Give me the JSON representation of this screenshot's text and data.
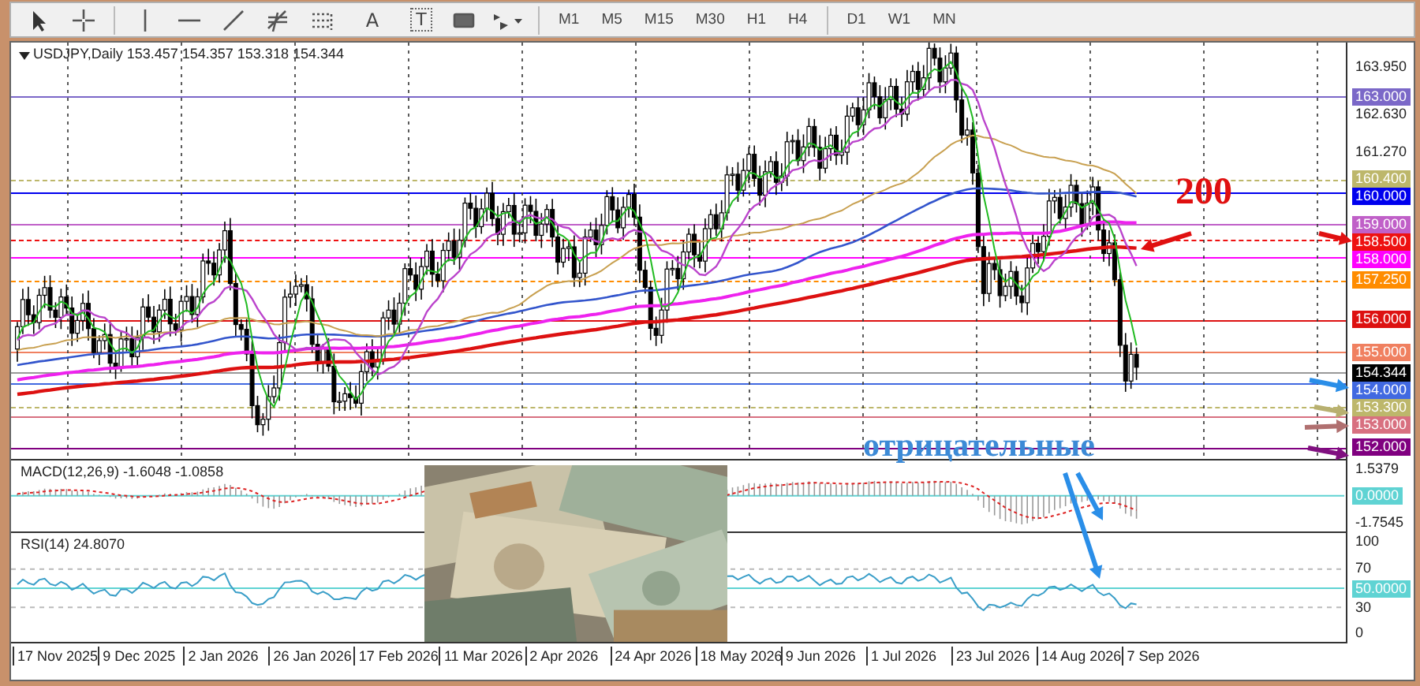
{
  "toolbar": {
    "tool_groups": [
      [
        {
          "kind": "cursor"
        },
        {
          "kind": "crosshair"
        }
      ],
      [
        {
          "kind": "vline"
        },
        {
          "kind": "hline"
        },
        {
          "kind": "trendline"
        },
        {
          "kind": "fibo"
        },
        {
          "kind": "grid"
        },
        {
          "kind": "text",
          "glyph": "A"
        },
        {
          "kind": "label",
          "glyph": "T"
        },
        {
          "kind": "rectangle"
        },
        {
          "kind": "shapes"
        }
      ]
    ],
    "timeframe_groups": [
      [
        {
          "label": "M1",
          "selected": false
        },
        {
          "label": "M5",
          "selected": false
        },
        {
          "label": "M15",
          "selected": false
        },
        {
          "label": "M30",
          "selected": false
        },
        {
          "label": "H1",
          "selected": false
        },
        {
          "label": "H4",
          "selected": false
        }
      ],
      [
        {
          "label": "D1",
          "selected": false
        },
        {
          "label": "W1",
          "selected": false
        },
        {
          "label": "MN",
          "selected": false
        }
      ]
    ]
  },
  "chart": {
    "header": "USDJPY,Daily  153.457 154.357 153.318 154.344",
    "price_axis": [
      {
        "label": "163.950",
        "kind": "tick"
      },
      {
        "label": "163.000",
        "kind": "level",
        "color": "#7b68c8",
        "dashed": false
      },
      {
        "label": "162.630",
        "kind": "tick"
      },
      {
        "label": "161.270",
        "kind": "tick"
      },
      {
        "label": "160.400",
        "kind": "level",
        "color": "#bdb76b",
        "dashed": true
      },
      {
        "label": "160.000",
        "kind": "level",
        "color": "#0000ee",
        "dashed": false
      },
      {
        "label": "159.000",
        "kind": "level",
        "color": "#c060c8",
        "dashed": false
      },
      {
        "label": "158.500",
        "kind": "level",
        "color": "#ee1111",
        "dashed": true
      },
      {
        "label": "158.000",
        "kind": "level",
        "color": "#ff00ff",
        "dashed": false
      },
      {
        "label": "157.250",
        "kind": "level",
        "color": "#ff8c00",
        "dashed": true
      },
      {
        "label": "156.000",
        "kind": "level",
        "color": "#dd1111",
        "dashed": false
      },
      {
        "label": "155.000",
        "kind": "level",
        "color": "#f08060",
        "dashed": false
      },
      {
        "label": "154.344",
        "kind": "current",
        "color": "#000000",
        "dashed": false
      },
      {
        "label": "154.000",
        "kind": "level",
        "color": "#4169e1",
        "dashed": false
      },
      {
        "label": "153.300",
        "kind": "level",
        "color": "#bdb76b",
        "dashed": true
      },
      {
        "label": "153.000",
        "kind": "level",
        "color": "#d87080",
        "dashed": false
      },
      {
        "label": "152.000",
        "kind": "level",
        "color": "#800080",
        "dashed": false
      }
    ],
    "annotations": [
      {
        "text": "200",
        "color": "#e01010"
      },
      {
        "text": "отрицательные",
        "color": "#3c8ad6"
      }
    ]
  },
  "macd": {
    "header": "MACD(12,26,9) -1.6048 -1.0858",
    "axis": [
      {
        "label": "1.5379",
        "kind": "tick"
      },
      {
        "label": "0.0000",
        "kind": "level",
        "color": "#5fd3d3"
      },
      {
        "label": "-1.7545",
        "kind": "tick"
      }
    ]
  },
  "rsi": {
    "header": "RSI(14) 24.8070",
    "axis": [
      {
        "label": "100",
        "kind": "tick"
      },
      {
        "label": "70",
        "kind": "tick"
      },
      {
        "label": "50.0000",
        "kind": "level",
        "color": "#5fd3d3"
      },
      {
        "label": "30",
        "kind": "tick"
      },
      {
        "label": "0",
        "kind": "tick"
      }
    ]
  },
  "dates": [
    "17 Nov 2025",
    "9 Dec 2025",
    "2 Jan 2026",
    "26 Jan 2026",
    "17 Feb 2026",
    "11 Mar 2026",
    "2 Apr 2026",
    "24 Apr 2026",
    "18 May 2026",
    "9 Jun 2026",
    "1 Jul 2026",
    "23 Jul 2026",
    "14 Aug 2026",
    "7 Sep 2026"
  ]
}
